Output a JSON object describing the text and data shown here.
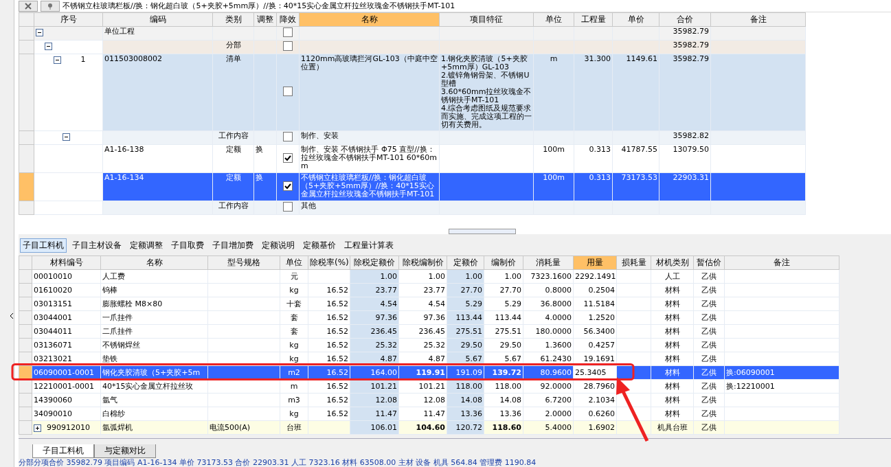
{
  "toolbar": {
    "description": "不锈钢立柱玻璃栏板//换：钢化超白玻（5+夹胶+5mm厚）//换：40*15实心金属立杆拉丝玫瑰金不锈钢扶手MT-101"
  },
  "top_grid": {
    "columns": [
      {
        "label": "序号",
        "highlighted": false
      },
      {
        "label": "编码",
        "highlighted": false
      },
      {
        "label": "类别",
        "highlighted": false
      },
      {
        "label": "调整",
        "highlighted": false
      },
      {
        "label": "降效",
        "highlighted": false
      },
      {
        "label": "名称",
        "highlighted": true
      },
      {
        "label": "项目特征",
        "highlighted": false
      },
      {
        "label": "单位",
        "highlighted": false
      },
      {
        "label": "工程量",
        "highlighted": false
      },
      {
        "label": "单价",
        "highlighted": false
      },
      {
        "label": "合价",
        "highlighted": false
      },
      {
        "label": "备注",
        "highlighted": false
      }
    ],
    "rows": [
      {
        "kind": "project",
        "code": "单位工程",
        "derated": false,
        "total": "35982.79",
        "selected": false,
        "expanded": true,
        "children": [
          {
            "kind": "division",
            "category": "分部",
            "derated": false,
            "total": "35982.79",
            "selected": false,
            "expanded": true,
            "children": [
              {
                "kind": "item",
                "seq": "1",
                "code": "011503008002",
                "category": "清单",
                "derated": false,
                "name": "1120mm高玻璃拦河GL-103（中庭中空位置）",
                "features": "1.钢化夹胶清玻（5+夹胶+5mm厚）GL-103\n2.镀锌角钢骨架、不锈钢U型槽\n3.60*60mm拉丝玫瑰金不锈钢扶手MT-101\n4.综合考虑图纸及规范要求而实施、完成这项工程的一切有关费用。",
                "unit": "m",
                "quantity": "31.300",
                "unit_price": "1149.61",
                "total": "35982.79",
                "selected": false,
                "expanded": true,
                "children": [
                  {
                    "kind": "work",
                    "category": "工作内容",
                    "derated": false,
                    "name": "制作、安装",
                    "total": "35982.82",
                    "selected": false,
                    "expanded": true,
                    "children": [
                      {
                        "kind": "quota",
                        "code": "A1-16-138",
                        "category": "定额",
                        "adjust": "换",
                        "derated": true,
                        "name": "制作、安装 不锈钢扶手 Φ75 直型//换：拉丝玫瑰金不锈钢扶手MT-101 60*60mm",
                        "unit": "100m",
                        "quantity": "0.313",
                        "unit_price": "41787.55",
                        "total": "13079.50",
                        "selected": false
                      },
                      {
                        "kind": "quota",
                        "code": "A1-16-134",
                        "category": "定额",
                        "adjust": "换",
                        "derated": true,
                        "name": "不锈钢立柱玻璃栏板//换：钢化超白玻（5+夹胶+5mm厚）//换：40*15实心金属立杆拉丝玫瑰金不锈钢扶手MT-101",
                        "unit": "100m",
                        "quantity": "0.313",
                        "unit_price": "73173.53",
                        "total": "22903.31",
                        "selected": true
                      }
                    ]
                  },
                  {
                    "kind": "work",
                    "category": "工作内容",
                    "derated": false,
                    "name": "其他",
                    "selected": false
                  }
                ]
              }
            ]
          }
        ]
      }
    ]
  },
  "detail_tabs": [
    {
      "label": "子目工料机",
      "selected": true
    },
    {
      "label": "子目主材设备",
      "selected": false
    },
    {
      "label": "定额调整",
      "selected": false
    },
    {
      "label": "子目取费",
      "selected": false
    },
    {
      "label": "子目增加费",
      "selected": false
    },
    {
      "label": "定额说明",
      "selected": false
    },
    {
      "label": "定额基价",
      "selected": false
    },
    {
      "label": "工程量计算表",
      "selected": false
    }
  ],
  "materials": {
    "columns": [
      {
        "label": "材料编号",
        "highlighted": false,
        "shaded": false
      },
      {
        "label": "名称",
        "highlighted": false,
        "shaded": false
      },
      {
        "label": "型号规格",
        "highlighted": false,
        "shaded": false
      },
      {
        "label": "单位",
        "highlighted": false,
        "shaded": false
      },
      {
        "label": "除税率(%)",
        "highlighted": false,
        "shaded": false
      },
      {
        "label": "除税定额价",
        "highlighted": false,
        "shaded": true
      },
      {
        "label": "除税编制价",
        "highlighted": false,
        "shaded": false
      },
      {
        "label": "定额价",
        "highlighted": false,
        "shaded": true
      },
      {
        "label": "编制价",
        "highlighted": false,
        "shaded": false
      },
      {
        "label": "消耗量",
        "highlighted": false,
        "shaded": false
      },
      {
        "label": "用量",
        "highlighted": true,
        "shaded": false
      },
      {
        "label": "损耗量",
        "highlighted": false,
        "shaded": false
      },
      {
        "label": "材机类别",
        "highlighted": false,
        "shaded": false
      },
      {
        "label": "暂估价",
        "highlighted": false,
        "shaded": false
      },
      {
        "label": "备注",
        "highlighted": false,
        "shaded": false
      }
    ],
    "rows": [
      {
        "kind": "material",
        "selected": false,
        "cells": [
          "00010010",
          "人工费",
          "",
          "元",
          "",
          "1.00",
          "1.00",
          "1.00",
          "1.00",
          "7323.1600",
          "2292.1491",
          "",
          "人工",
          "乙供",
          ""
        ]
      },
      {
        "kind": "material",
        "selected": false,
        "cells": [
          "01610020",
          "钨棒",
          "",
          "kg",
          "16.52",
          "23.77",
          "23.77",
          "27.70",
          "27.70",
          "0.8000",
          "0.2504",
          "",
          "材料",
          "乙供",
          ""
        ]
      },
      {
        "kind": "material",
        "selected": false,
        "cells": [
          "03013151",
          "膨胀螺栓 M8×80",
          "",
          "十套",
          "16.52",
          "4.54",
          "4.54",
          "5.29",
          "5.29",
          "36.8000",
          "11.5184",
          "",
          "材料",
          "乙供",
          ""
        ]
      },
      {
        "kind": "material",
        "selected": false,
        "cells": [
          "03044001",
          "一爪挂件",
          "",
          "套",
          "16.52",
          "97.36",
          "97.36",
          "113.44",
          "113.44",
          "4.0000",
          "1.2520",
          "",
          "材料",
          "乙供",
          ""
        ]
      },
      {
        "kind": "material",
        "selected": false,
        "cells": [
          "03044011",
          "二爪挂件",
          "",
          "套",
          "16.52",
          "236.45",
          "236.45",
          "275.51",
          "275.51",
          "180.0000",
          "56.3400",
          "",
          "材料",
          "乙供",
          ""
        ]
      },
      {
        "kind": "material",
        "selected": false,
        "cells": [
          "03136071",
          "不锈钢焊丝",
          "",
          "kg",
          "16.52",
          "25.32",
          "25.32",
          "29.50",
          "29.50",
          "1.3600",
          "0.4257",
          "",
          "材料",
          "乙供",
          ""
        ]
      },
      {
        "kind": "material",
        "selected": false,
        "cells": [
          "03213021",
          "垫铁",
          "",
          "kg",
          "16.52",
          "4.87",
          "4.87",
          "5.67",
          "5.67",
          "61.2430",
          "19.1691",
          "",
          "材料",
          "乙供",
          ""
        ]
      },
      {
        "kind": "material",
        "selected": true,
        "cells": [
          "06090001-0001",
          "钢化夹胶清玻（5+夹胶+5m",
          "",
          "m2",
          "16.52",
          "164.00",
          {
            "text": "119.91",
            "bold": true
          },
          "191.09",
          {
            "text": "139.72",
            "bold": true
          },
          "80.9600",
          "25.3405",
          "",
          "材料",
          "乙供",
          "换:06090001"
        ]
      },
      {
        "kind": "material",
        "selected": false,
        "cells": [
          "12210001-0001",
          "40*15实心金属立杆拉丝玫",
          "",
          "m",
          "16.52",
          "101.21",
          "101.21",
          "118.00",
          "118.00",
          "92.0000",
          "28.7960",
          "",
          "材料",
          "乙供",
          "换:12210001"
        ]
      },
      {
        "kind": "material",
        "selected": false,
        "cells": [
          "14390060",
          "氩气",
          "",
          "m3",
          "16.52",
          "12.08",
          "12.08",
          "14.08",
          "14.08",
          "6.7200",
          "2.1034",
          "",
          "材料",
          "乙供",
          ""
        ]
      },
      {
        "kind": "material",
        "selected": false,
        "cells": [
          "34090010",
          "白棉纱",
          "",
          "kg",
          "16.52",
          "11.47",
          "11.47",
          "13.36",
          "13.36",
          "2.0000",
          "0.6260",
          "",
          "材料",
          "乙供",
          ""
        ]
      },
      {
        "kind": "machine",
        "selected": false,
        "expanded": false,
        "cells": [
          "990912010",
          "氩弧焊机",
          "电流500(A)",
          "台班",
          "",
          "106.01",
          {
            "text": "104.60",
            "bold": true
          },
          "120.72",
          {
            "text": "118.60",
            "bold": true
          },
          "5.4000",
          "1.6902",
          "",
          "机具台班",
          "乙供",
          ""
        ]
      }
    ]
  },
  "bottom_tabs": [
    {
      "label": "子目工料机",
      "selected": true
    },
    {
      "label": "与定额对比",
      "selected": false
    }
  ],
  "status_bar": "分部分项合价 35982.79  项目编码 A1-16-134  单价 73173.53  合价 22903.31  人工 7323.16  材料 63508.00  主材  设备  机具 564.84  管理费 1190.84"
}
